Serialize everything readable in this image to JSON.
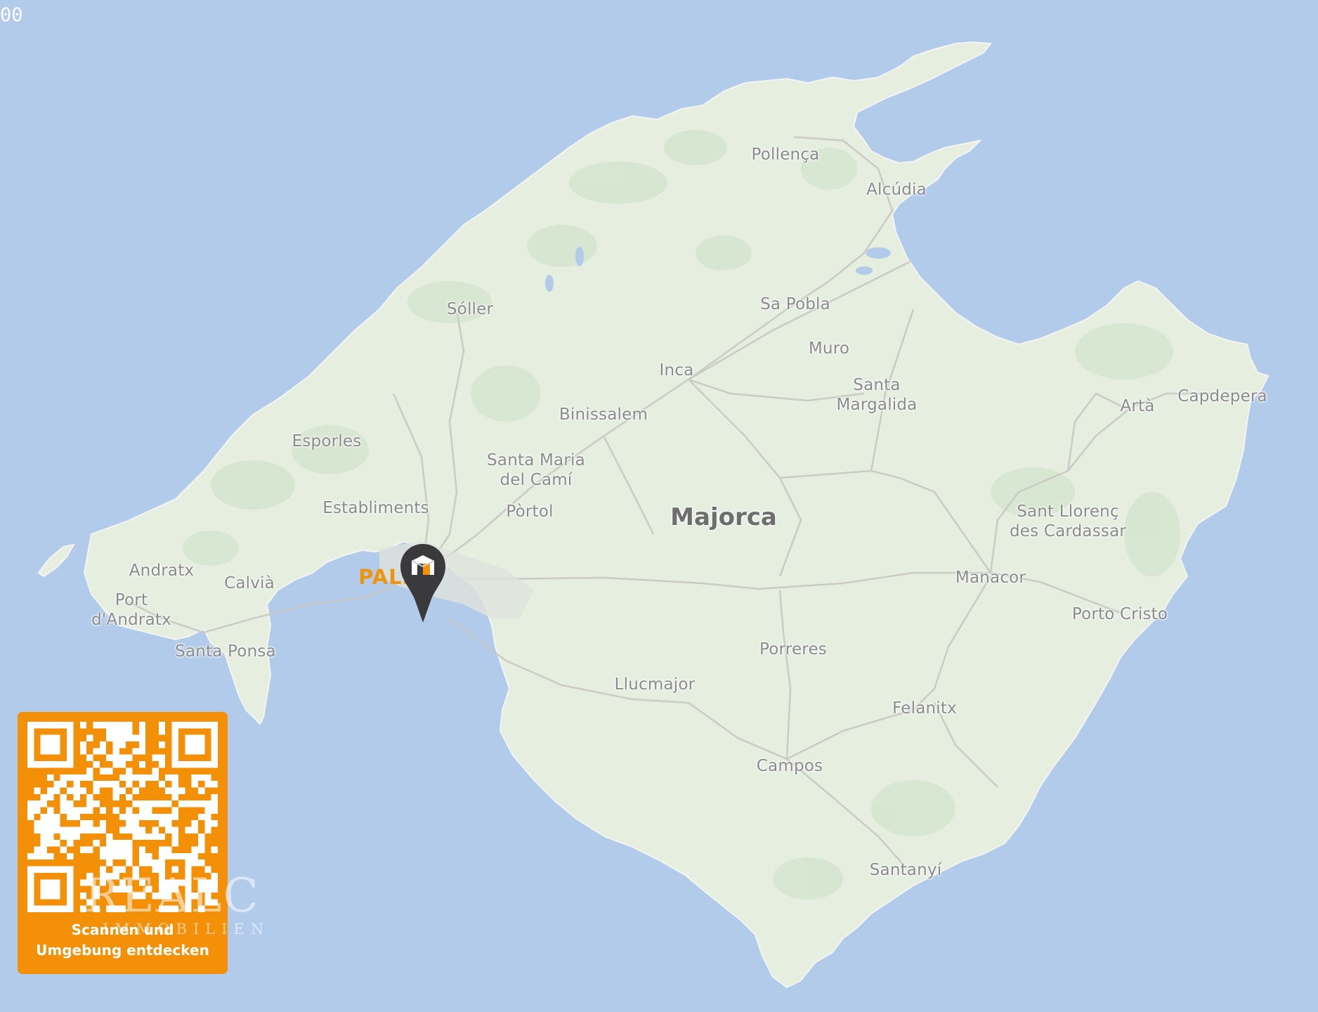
{
  "top_left_text": "00",
  "map": {
    "island_label": "Majorca",
    "capital_label": "PALMA",
    "places": [
      {
        "id": "pollenca",
        "label": "Pollença"
      },
      {
        "id": "alcudia",
        "label": "Alcúdia"
      },
      {
        "id": "soller",
        "label": "Sóller"
      },
      {
        "id": "sa-pobla",
        "label": "Sa Pobla"
      },
      {
        "id": "muro",
        "label": "Muro"
      },
      {
        "id": "inca",
        "label": "Inca"
      },
      {
        "id": "santa-margalida",
        "label": "Santa\nMargalida"
      },
      {
        "id": "binissalem",
        "label": "Binissalem"
      },
      {
        "id": "esporles",
        "label": "Esporles"
      },
      {
        "id": "santa-maria",
        "label": "Santa Maria\ndel Camí"
      },
      {
        "id": "establiments",
        "label": "Establiments"
      },
      {
        "id": "portol",
        "label": "Pòrtol"
      },
      {
        "id": "arta",
        "label": "Artà"
      },
      {
        "id": "capdepera",
        "label": "Capdepera"
      },
      {
        "id": "sant-llorenc",
        "label": "Sant Llorenç\ndes Cardassar"
      },
      {
        "id": "andratx",
        "label": "Andratx"
      },
      {
        "id": "calvia",
        "label": "Calvià"
      },
      {
        "id": "port-andratx",
        "label": "Port\nd'Andratx"
      },
      {
        "id": "manacor",
        "label": "Manacor"
      },
      {
        "id": "porto-cristo",
        "label": "Porto Cristo"
      },
      {
        "id": "santa-ponsa",
        "label": "Santa Ponsa"
      },
      {
        "id": "porreres",
        "label": "Porreres"
      },
      {
        "id": "llucmajor",
        "label": "Llucmajor"
      },
      {
        "id": "felanitx",
        "label": "Felanitx"
      },
      {
        "id": "campos",
        "label": "Campos"
      },
      {
        "id": "santanyi",
        "label": "Santanyí"
      }
    ],
    "marker_icon": "location-pin-icon"
  },
  "qr_card": {
    "caption_line1": "Scannen und",
    "caption_line2": "Umgebung entdecken"
  },
  "watermark": {
    "logo": "REALC",
    "sub": "IMMOBILIEN"
  },
  "colors": {
    "sea": "#b3cbea",
    "land": "#e6eee0",
    "accent": "#f39008",
    "pin": "#3a3a3c"
  }
}
